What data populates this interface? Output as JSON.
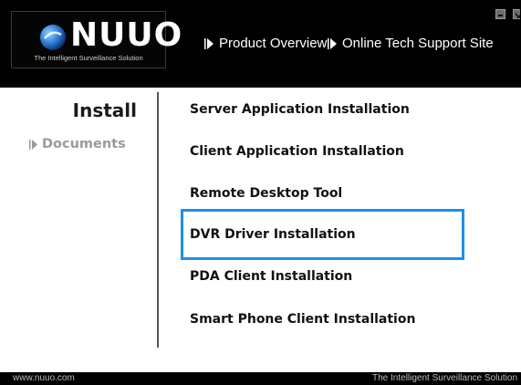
{
  "header": {
    "logo_text": "NUUO",
    "logo_tagline": "The Intelligent Surveillance Solution",
    "nav": [
      {
        "label": "Product Overview"
      },
      {
        "label": "Online Tech Support Site"
      }
    ]
  },
  "sidebar": {
    "title": "Install",
    "documents_label": "Documents"
  },
  "menu": {
    "items": [
      {
        "label": "Server Application Installation"
      },
      {
        "label": "Client Application Installation"
      },
      {
        "label": "Remote Desktop Tool"
      },
      {
        "label": "DVR Driver Installation"
      },
      {
        "label": "PDA Client Installation"
      },
      {
        "label": "Smart Phone Client Installation"
      }
    ],
    "selected_index": 3
  },
  "footer": {
    "url": "www.nuuo.com",
    "tagline": "The Intelligent Surveillance Solution"
  },
  "colors": {
    "header_bg": "#000000",
    "highlight": "#1e90e6",
    "menu_text": "#111111",
    "muted_text": "#9a9a9a"
  },
  "icons": [
    "nuuo-logo-icon",
    "arrow-right-icon",
    "minimize-icon",
    "close-icon"
  ]
}
